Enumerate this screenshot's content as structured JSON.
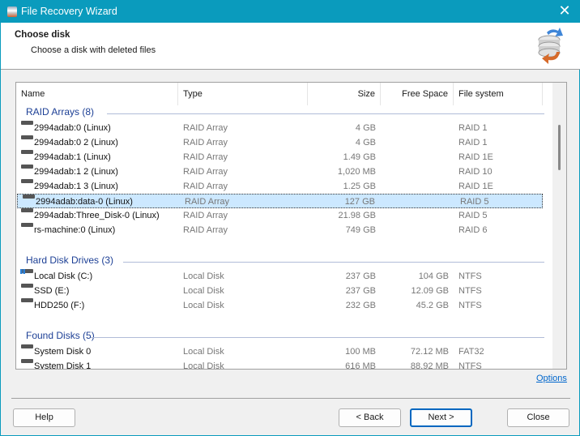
{
  "window": {
    "title": "File Recovery Wizard",
    "close": "✕"
  },
  "header": {
    "title": "Choose disk",
    "subtitle": "Choose a disk with deleted files"
  },
  "columns": {
    "name": "Name",
    "type": "Type",
    "size": "Size",
    "free": "Free Space",
    "fs": "File system"
  },
  "groups": [
    {
      "label": "RAID Arrays (8)",
      "rows": [
        {
          "name": "2994adab:0 (Linux)",
          "type": "RAID Array",
          "size": "4 GB",
          "free": "",
          "fs": "RAID 1"
        },
        {
          "name": "2994adab:0 2 (Linux)",
          "type": "RAID Array",
          "size": "4 GB",
          "free": "",
          "fs": "RAID 1"
        },
        {
          "name": "2994adab:1 (Linux)",
          "type": "RAID Array",
          "size": "1.49 GB",
          "free": "",
          "fs": "RAID 1E"
        },
        {
          "name": "2994adab:1 2 (Linux)",
          "type": "RAID Array",
          "size": "1,020 MB",
          "free": "",
          "fs": "RAID 10"
        },
        {
          "name": "2994adab:1 3 (Linux)",
          "type": "RAID Array",
          "size": "1.25 GB",
          "free": "",
          "fs": "RAID 1E"
        },
        {
          "name": "2994adab:data-0 (Linux)",
          "type": "RAID Array",
          "size": "127 GB",
          "free": "",
          "fs": "RAID 5",
          "selected": true
        },
        {
          "name": "2994adab:Three_Disk-0 (Linux)",
          "type": "RAID Array",
          "size": "21.98 GB",
          "free": "",
          "fs": "RAID 5"
        },
        {
          "name": "rs-machine:0 (Linux)",
          "type": "RAID Array",
          "size": "749 GB",
          "free": "",
          "fs": "RAID 6"
        }
      ]
    },
    {
      "label": "Hard Disk Drives (3)",
      "rows": [
        {
          "name": "Local Disk (C:)",
          "type": "Local Disk",
          "size": "237 GB",
          "free": "104 GB",
          "fs": "NTFS",
          "icon": "windows-disk"
        },
        {
          "name": "SSD (E:)",
          "type": "Local Disk",
          "size": "237 GB",
          "free": "12.09 GB",
          "fs": "NTFS"
        },
        {
          "name": "HDD250 (F:)",
          "type": "Local Disk",
          "size": "232 GB",
          "free": "45.2 GB",
          "fs": "NTFS"
        }
      ]
    },
    {
      "label": "Found Disks (5)",
      "rows": [
        {
          "name": "System Disk 0",
          "type": "Local Disk",
          "size": "100 MB",
          "free": "72.12 MB",
          "fs": "FAT32"
        },
        {
          "name": "System Disk 1",
          "type": "Local Disk",
          "size": "616 MB",
          "free": "88.92 MB",
          "fs": "NTFS"
        }
      ]
    }
  ],
  "options_link": "Options",
  "buttons": {
    "help": "Help",
    "back": "< Back",
    "next": "Next >",
    "close": "Close"
  },
  "colors": {
    "titlebar": "#0a9bbd",
    "group": "#1c3f95",
    "selection": "#cce8ff"
  }
}
